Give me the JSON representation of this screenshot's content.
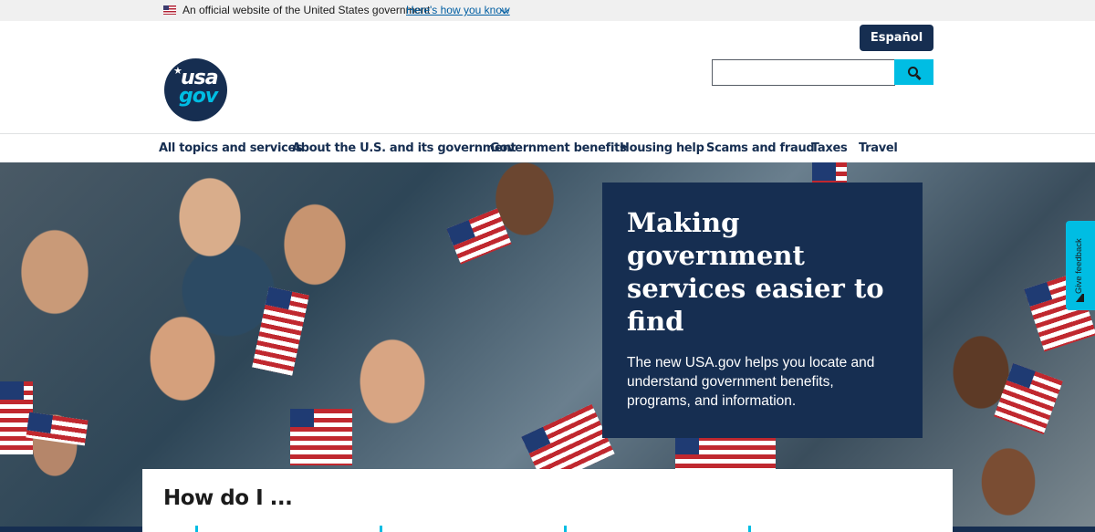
{
  "gov_banner": {
    "text": "An official website of the United States government",
    "link": "Here's how you know",
    "flag_icon": "us-flag-icon",
    "chevron_icon": "chevron-down-icon"
  },
  "header": {
    "language_button": "Español",
    "search": {
      "placeholder": "",
      "value": "",
      "button_icon": "search-icon"
    },
    "logo": {
      "star": "★",
      "line1": "usa",
      "line2": "gov"
    }
  },
  "nav": {
    "items": [
      "All topics and services",
      "About the U.S. and its government",
      "Government benefits",
      "Housing help",
      "Scams and fraud",
      "Taxes",
      "Travel"
    ]
  },
  "hero": {
    "title": "Making government services easier to find",
    "description": "The new USA.gov helps you locate and understand government benefits, programs, and information."
  },
  "how_do_i": {
    "title": "How do I ..."
  },
  "feedback": {
    "label": "Give feedback",
    "icon": "feedback-icon"
  },
  "colors": {
    "navy": "#162e51",
    "cyan": "#00bde3",
    "banner_bg": "#f0f0f0",
    "link_blue": "#005ea2"
  }
}
